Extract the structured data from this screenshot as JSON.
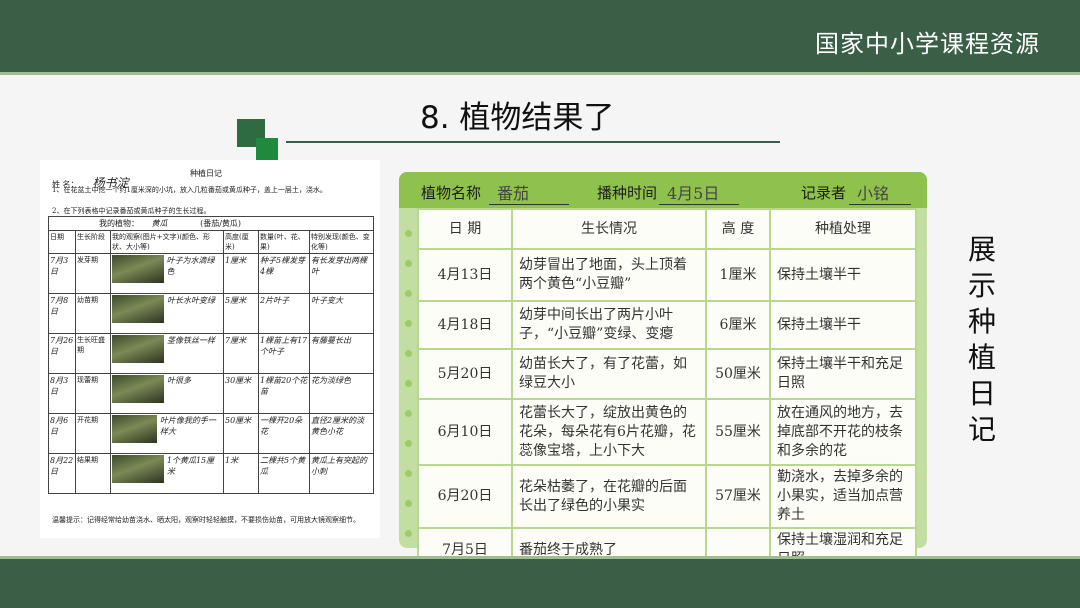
{
  "brand": "国家中小学课程资源",
  "title": "8. 植物结果了",
  "side_text": "展示种植日记",
  "scan": {
    "heading": "种植日记",
    "name_label": "姓 名：",
    "name_value": "杨书淀",
    "instruction1": "1、在花盆土中挖一个约1厘米深的小坑，放入几粒番茄或黄瓜种子，盖上一层土，浇水。",
    "instruction2": "2、在下列表格中记录番茄或黄瓜种子的生长过程。",
    "my_plant_label": "我的植物：",
    "my_plant_value": "黄瓜",
    "my_plant_hint": "(番茄/黄瓜)",
    "headers": [
      "日期",
      "生长阶段",
      "我的观察(图片+文字)(颜色、形状、大小等)",
      "高度(厘米)",
      "数量(叶、花、果)",
      "特别发现(颜色、变化等)"
    ],
    "rows": [
      {
        "date": "7月3日",
        "stage": "发芽期",
        "obs": "叶子为水滴绿色",
        "height": "1厘米",
        "count": "种子5棵发芽4棵",
        "note": "有长发芽出两棵叶"
      },
      {
        "date": "7月8日",
        "stage": "幼苗期",
        "obs": "叶长水叶变绿",
        "height": "5厘米",
        "count": "2片叶子",
        "note": "叶子变大"
      },
      {
        "date": "7月26日",
        "stage": "生长旺盛期",
        "obs": "茎像铁丝一样",
        "height": "7厘米",
        "count": "1棵苗上有17个叶子",
        "note": "有藤蔓长出"
      },
      {
        "date": "8月3日",
        "stage": "现蕾期",
        "obs": "叶很多",
        "height": "30厘米",
        "count": "1棵苗20个花苗",
        "note": "花为淡绿色"
      },
      {
        "date": "8月6日",
        "stage": "开花期",
        "obs": "叶片像我的手一样大",
        "height": "50厘米",
        "count": "一棵开20朵花",
        "note": "直径2厘米的淡黄色小花"
      },
      {
        "date": "8月22日",
        "stage": "结果期",
        "obs": "1个黄瓜15厘米",
        "height": "1米",
        "count": "二棵共5个黄瓜",
        "note": "黄瓜上有突起的小刺"
      }
    ],
    "footer": "温馨提示：记得经常给幼苗浇水、晒太阳，观察时轻轻触摸，不要损伤幼苗，可用放大镜观察细节。"
  },
  "card": {
    "plant_label": "植物名称",
    "plant_value": "番茄",
    "sow_label": "播种时间",
    "sow_value": "4月5日",
    "recorder_label": "记录者",
    "recorder_value": "小铭",
    "headers": [
      "日 期",
      "生长情况",
      "高 度",
      "种植处理"
    ],
    "rows": [
      {
        "date": "4月13日",
        "growth": "幼芽冒出了地面，头上顶着两个黄色“小豆瓣”",
        "height": "1厘米",
        "care": "保持土壤半干"
      },
      {
        "date": "4月18日",
        "growth": "幼芽中间长出了两片小叶子，“小豆瓣”变绿、变瘪",
        "height": "6厘米",
        "care": "保持土壤半干"
      },
      {
        "date": "5月20日",
        "growth": "幼苗长大了，有了花蕾，如绿豆大小",
        "height": "50厘米",
        "care": "保持土壤半干和充足日照"
      },
      {
        "date": "6月10日",
        "growth": "花蕾长大了，绽放出黄色的花朵，每朵花有6片花瓣，花蕊像宝塔，上小下大",
        "height": "55厘米",
        "care": "放在通风的地方，去掉底部不开花的枝条和多余的花"
      },
      {
        "date": "6月20日",
        "growth": "花朵枯萎了，在花瓣的后面长出了绿色的小果实",
        "height": "57厘米",
        "care": "勤浇水，去掉多余的小果实，适当加点营养土"
      },
      {
        "date": "7月5日",
        "growth": "番茄终于成熟了",
        "height": "",
        "care": "保持土壤湿润和充足日照"
      }
    ]
  }
}
